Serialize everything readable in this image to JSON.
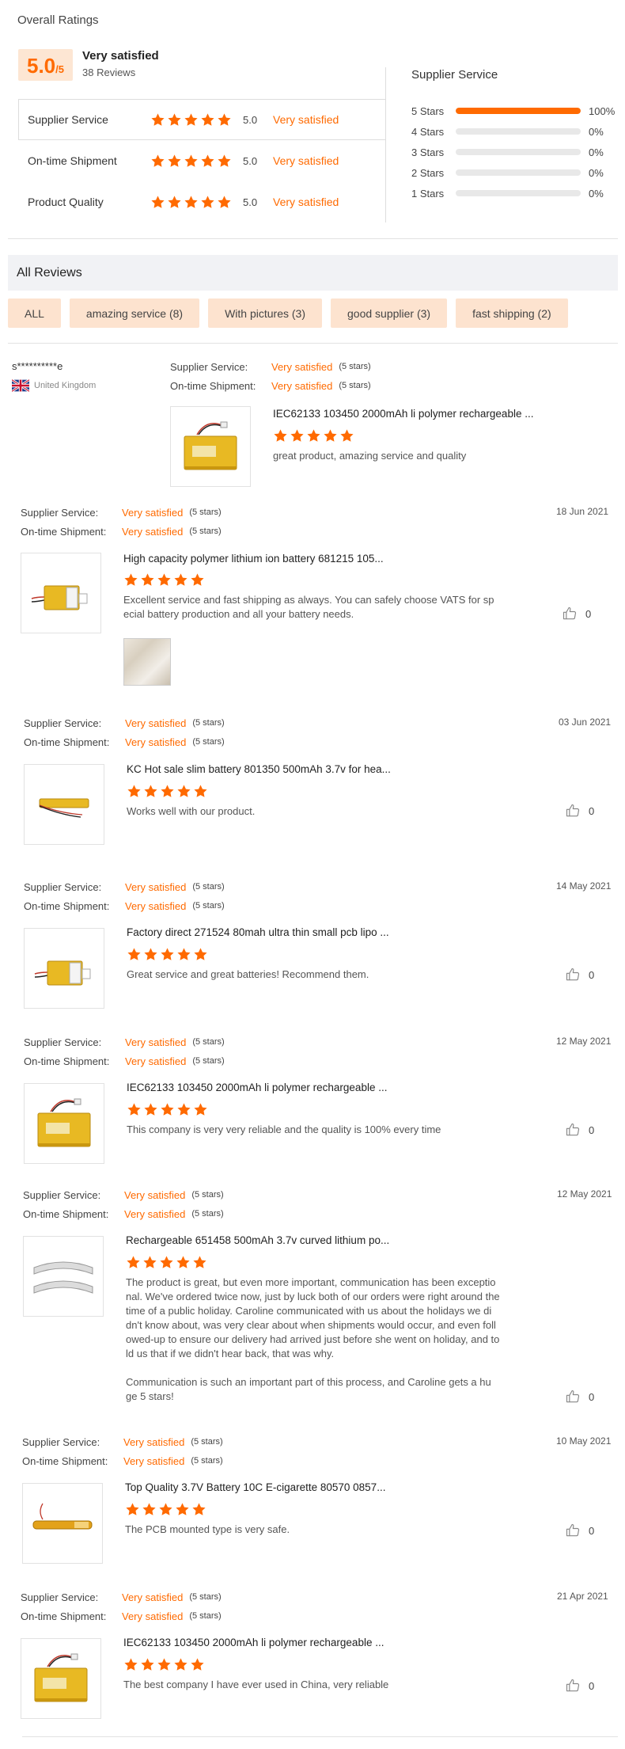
{
  "overall": {
    "title": "Overall Ratings",
    "score": "5.0",
    "score_suffix": "/5",
    "label": "Very satisfied",
    "reviews_count": "38 Reviews",
    "categories": [
      {
        "label": "Supplier Service",
        "value": "5.0",
        "sat": "Very satisfied",
        "stars": 5
      },
      {
        "label": "On-time Shipment",
        "value": "5.0",
        "sat": "Very satisfied",
        "stars": 5
      },
      {
        "label": "Product Quality",
        "value": "5.0",
        "sat": "Very satisfied",
        "stars": 5
      }
    ]
  },
  "supplier_service": {
    "title": "Supplier Service",
    "bars": [
      {
        "label": "5  Stars",
        "pct": "100%",
        "fraction": 1.0
      },
      {
        "label": "4  Stars",
        "pct": "0%",
        "fraction": 0
      },
      {
        "label": "3  Stars",
        "pct": "0%",
        "fraction": 0
      },
      {
        "label": "2  Stars",
        "pct": "0%",
        "fraction": 0
      },
      {
        "label": "1  Stars",
        "pct": "0%",
        "fraction": 0
      }
    ]
  },
  "all_reviews": {
    "title": "All Reviews",
    "filters": [
      "ALL",
      "amazing service (8)",
      "With pictures (3)",
      "good supplier (3)",
      "fast shipping (2)"
    ]
  },
  "labels": {
    "supplier_service": "Supplier Service:",
    "ontime_shipment": "On-time Shipment:",
    "very_satisfied": "Very satisfied",
    "five_stars": "(5 stars)"
  },
  "reviews": [
    {
      "reviewer": "s**********e",
      "country": "United Kingdom",
      "product": "IEC62133 103450 2000mAh li polymer rechargeable ...",
      "text": "great product, amazing service and quality"
    },
    {
      "date": "18 Jun 2021",
      "product": "High capacity polymer lithium ion battery 681215 105...",
      "text_lines": [
        "Excellent service and fast shipping as always. You can safely choose VATS for sp",
        "ecial battery production and all your battery needs."
      ],
      "likes": "0"
    },
    {
      "date": "03 Jun 2021",
      "product": "KC Hot sale slim battery 801350 500mAh 3.7v for hea...",
      "text": "Works well with our product.",
      "likes": "0"
    },
    {
      "date": "14 May 2021",
      "product": "Factory direct 271524 80mah ultra thin small pcb lipo ...",
      "text": "Great service and great batteries! Recommend them.",
      "likes": "0"
    },
    {
      "date": "12 May 2021",
      "product": "IEC62133 103450 2000mAh li polymer rechargeable ...",
      "text": "This company is very very reliable and the quality is 100% every time",
      "likes": "0"
    },
    {
      "date": "12 May 2021",
      "product": "Rechargeable 651458 500mAh 3.7v curved lithium po...",
      "text_lines": [
        "The product is great, but even more important, communication has been exceptio",
        "nal. We've ordered twice now, just by luck both of our orders were right around the",
        "time of a public holiday. Caroline communicated with us about the holidays we di",
        "dn't know about, was very clear about when shipments would occur, and even foll",
        "owed-up to ensure our delivery had arrived just before she went on holiday, and to",
        "ld us that if we didn't hear back, that was why.",
        "",
        "Communication is such an important part of this process, and Caroline gets a hu",
        "ge 5 stars!"
      ],
      "likes": "0"
    },
    {
      "date": "10 May 2021",
      "product": "Top Quality 3.7V Battery 10C E-cigarette 80570 0857...",
      "text": "The PCB mounted type is very safe.",
      "likes": "0"
    },
    {
      "date": "21 Apr 2021",
      "product": "IEC62133 103450 2000mAh li polymer rechargeable ...",
      "text": "The best company I have ever used in China, very reliable",
      "likes": "0"
    }
  ],
  "colors": {
    "accent": "#ff6a00",
    "filter_bg": "#fde3cf",
    "score_bg": "#fde6d3",
    "panel_bg": "#f1f2f5"
  },
  "icons": [
    "star-icon",
    "thumbs-up-icon",
    "uk-flag-icon",
    "battery-product-image"
  ]
}
